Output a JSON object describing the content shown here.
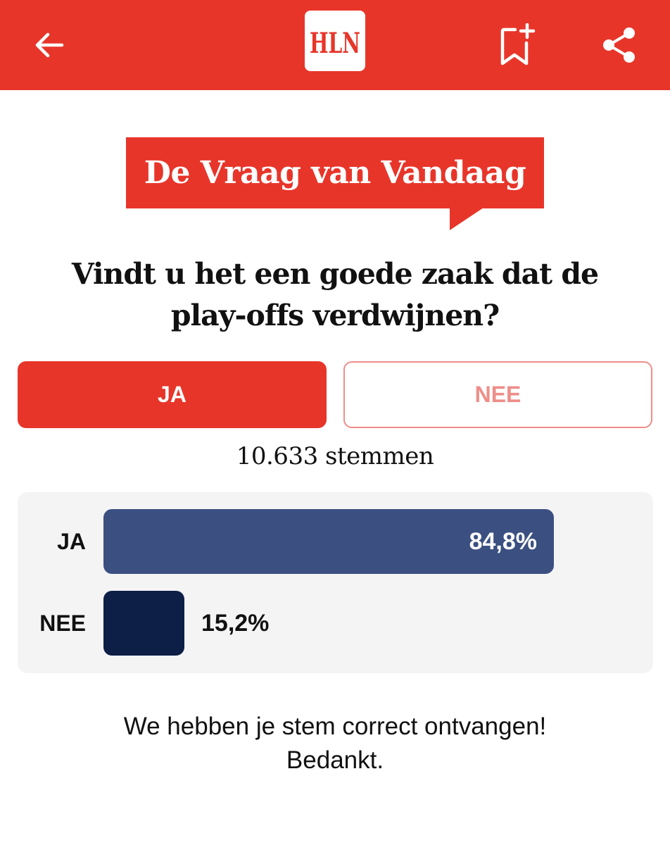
{
  "header": {
    "logo_text": "HLN",
    "icons": [
      "back-arrow-icon",
      "bookmark-add-icon",
      "share-icon"
    ],
    "brand_color": "#e8352a"
  },
  "poll": {
    "badge": "De Vraag van Vandaag",
    "question": "Vindt u het een goede zaak dat de play-offs verdwijnen?",
    "options": [
      {
        "label": "JA",
        "selected": true
      },
      {
        "label": "NEE",
        "selected": false
      }
    ],
    "votes_text": "10.633 stemmen",
    "results": [
      {
        "label": "JA",
        "percent_text": "84,8%",
        "fraction": 0.848,
        "color": "#3b5081"
      },
      {
        "label": "NEE",
        "percent_text": "15,2%",
        "fraction": 0.152,
        "color": "#0d1f47"
      }
    ],
    "confirmation_line1": "We hebben je stem correct ontvangen!",
    "confirmation_line2": "Bedankt."
  }
}
